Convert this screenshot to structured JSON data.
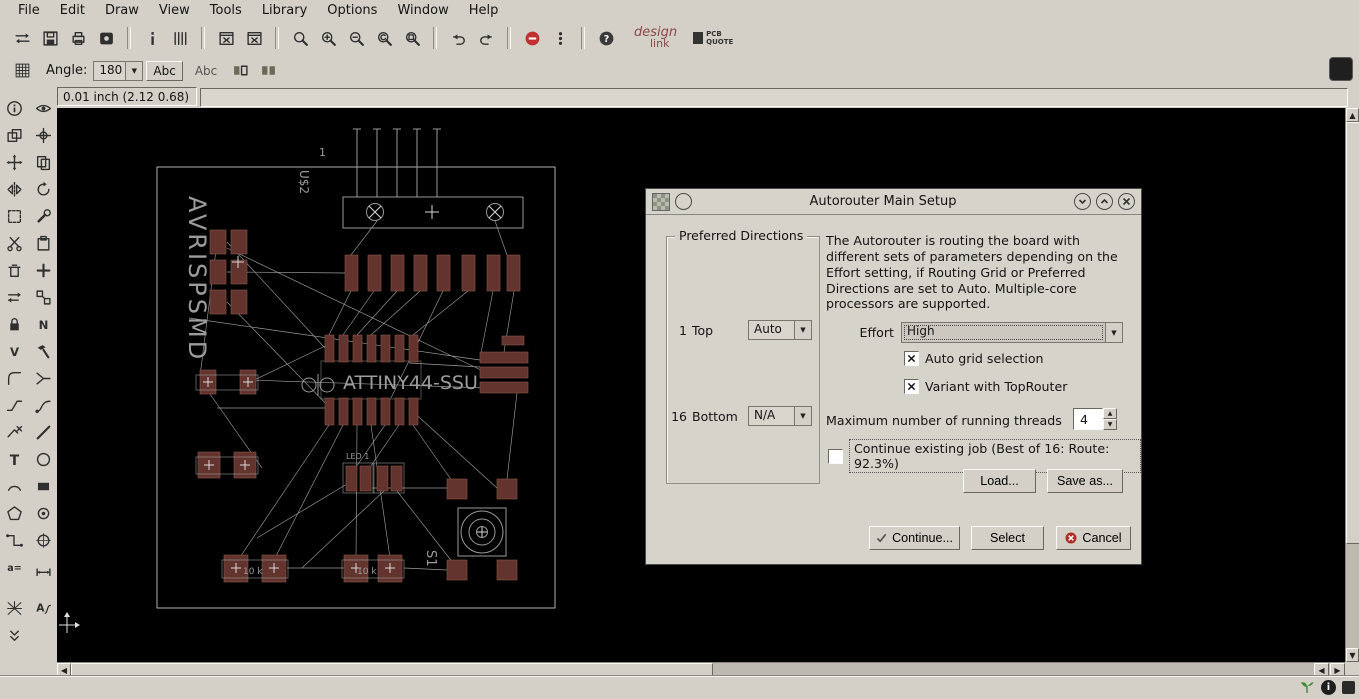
{
  "menu": {
    "items": [
      "File",
      "Edit",
      "Draw",
      "View",
      "Tools",
      "Library",
      "Options",
      "Window",
      "Help"
    ]
  },
  "toolbar": {
    "angle_label": "Angle:",
    "angle_value": "180",
    "abc_label": "Abc",
    "abc2_label": "Abc",
    "design_link_line1": "design",
    "design_link_line2": "link",
    "pcb_quote_line1": "PCB",
    "pcb_quote_line2": "QUOTE"
  },
  "command_bar": {
    "coords": "0.01 inch (2.12 0.68)"
  },
  "sidebar": {
    "tools": [
      "info",
      "show",
      "display",
      "mark",
      "move",
      "copy",
      "mirror",
      "rotate",
      "group",
      "change",
      "cut",
      "paste",
      "delete",
      "add",
      "pinswap",
      "replace",
      "lock",
      "name",
      "value",
      "smash",
      "miter",
      "split",
      "optimize",
      "route",
      "ripup",
      "wire",
      "text",
      "circle",
      "arc",
      "rect",
      "polygon",
      "via",
      "signal",
      "hole",
      "attribute",
      "dimension",
      "ratsnest",
      "autorouter",
      "more-tools"
    ]
  },
  "canvas": {
    "board": {
      "name": "AVRISPSMD",
      "header_ref": "U$2",
      "pin1": "1",
      "mcu": "ATTINY44-SSU",
      "switch_ref": "S1",
      "led_ref": "LED 1",
      "r1_value": "10 k",
      "r2_value": "10 k"
    }
  },
  "dialog": {
    "title": "Autorouter Main Setup",
    "group_title": "Preferred Directions",
    "rows": [
      {
        "num": "1",
        "label": "Top",
        "value": "Auto"
      },
      {
        "num": "16",
        "label": "Bottom",
        "value": "N/A"
      }
    ],
    "description": "The Autorouter is routing the board with different sets of parameters depending on the Effort setting, if Routing Grid or Preferred Directions are set to Auto. Multiple-core processors are supported.",
    "effort_label": "Effort",
    "effort_value": "High",
    "auto_grid_label": "Auto grid selection",
    "auto_grid_checked": true,
    "variant_label": "Variant with TopRouter",
    "variant_checked": true,
    "threads_label": "Maximum number of running threads",
    "threads_value": "4",
    "continue_job_label": "Continue existing job (Best of 16: Route: 92.3%)",
    "continue_job_checked": false,
    "load_label": "Load...",
    "save_as_label": "Save as...",
    "continue_label": "Continue...",
    "select_label": "Select",
    "cancel_label": "Cancel",
    "status_colors": {
      "cancel_icon": "#b42c24",
      "stop_icon": "#c03030"
    }
  }
}
